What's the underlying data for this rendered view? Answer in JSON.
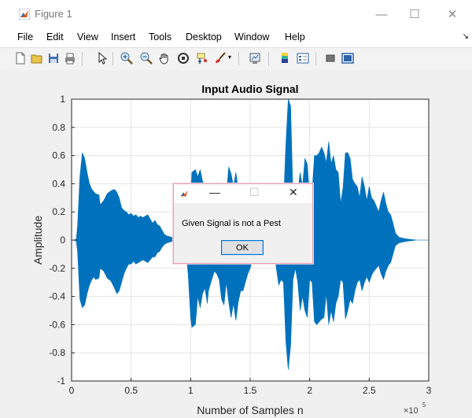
{
  "window": {
    "title": "Figure 1",
    "controls": {
      "minimize": "—",
      "maximize": "☐",
      "close": "✕"
    }
  },
  "menu": [
    "File",
    "Edit",
    "View",
    "Insert",
    "Tools",
    "Desktop",
    "Window",
    "Help"
  ],
  "menu_overflow": "↘",
  "toolbar": {
    "icons": [
      "new-figure-icon",
      "open-file-icon",
      "save-icon",
      "print-icon",
      "pointer-icon",
      "zoom-in-icon",
      "zoom-out-icon",
      "pan-icon",
      "rotate-3d-icon",
      "data-cursor-icon",
      "brush-icon",
      "link-plot-icon",
      "colorbar-icon",
      "legend-icon",
      "hide-plot-tools-icon",
      "show-plot-tools-icon"
    ]
  },
  "chart_data": {
    "type": "area",
    "title": "Input Audio Signal",
    "xlabel": "Number of Samples n",
    "ylabel": "Amplitude",
    "x_exponent_label": "×10",
    "x_exponent": "5",
    "xlim": [
      0,
      3
    ],
    "ylim": [
      -1,
      1
    ],
    "xticks": [
      "0",
      "0.5",
      "1",
      "1.5",
      "2",
      "2.5",
      "3"
    ],
    "yticks": [
      "1",
      "0.8",
      "0.6",
      "0.4",
      "0.2",
      "0",
      "-0.2",
      "-0.4",
      "-0.6",
      "-0.8",
      "-1"
    ],
    "grid": true,
    "color": "#0072bd",
    "envelope_x": [
      0.0,
      0.02,
      0.04,
      0.05,
      0.07,
      0.09,
      0.11,
      0.13,
      0.15,
      0.17,
      0.19,
      0.2,
      0.23,
      0.24,
      0.27,
      0.3,
      0.33,
      0.36,
      0.38,
      0.4,
      0.42,
      0.44,
      0.46,
      0.48,
      0.5,
      0.52,
      0.54,
      0.56,
      0.58,
      0.6,
      0.62,
      0.64,
      0.66,
      0.68,
      0.7,
      0.72,
      0.74,
      0.76,
      0.78,
      0.8,
      0.84,
      0.9,
      0.95,
      0.96,
      0.98,
      1.0,
      1.01,
      1.04,
      1.06,
      1.08,
      1.1,
      1.12,
      1.14,
      1.15,
      1.17,
      1.2,
      1.22,
      1.24,
      1.26,
      1.28,
      1.3,
      1.32,
      1.34,
      1.36,
      1.38,
      1.4,
      1.42,
      1.44,
      1.46,
      1.48,
      1.5,
      1.52,
      1.54,
      1.56,
      1.58,
      1.6,
      1.62,
      1.64,
      1.66,
      1.68,
      1.7,
      1.72,
      1.74,
      1.76,
      1.78,
      1.8,
      1.82,
      1.84,
      1.86,
      1.88,
      1.9,
      1.92,
      1.94,
      1.96,
      1.98,
      2.0,
      2.02,
      2.04,
      2.06,
      2.08,
      2.1,
      2.12,
      2.14,
      2.16,
      2.18,
      2.2,
      2.22,
      2.24,
      2.26,
      2.28,
      2.3,
      2.32,
      2.34,
      2.36,
      2.38,
      2.4,
      2.42,
      2.44,
      2.46,
      2.48,
      2.5,
      2.52,
      2.54,
      2.56,
      2.58,
      2.6,
      2.62,
      2.64,
      2.66,
      2.68,
      2.7,
      2.72,
      2.75,
      2.8,
      2.9,
      3.0
    ],
    "envelope_upper": [
      0.0,
      0.0,
      0.01,
      0.1,
      0.45,
      0.62,
      0.58,
      0.48,
      0.4,
      0.36,
      0.34,
      0.33,
      0.32,
      0.25,
      0.28,
      0.33,
      0.35,
      0.36,
      0.34,
      0.3,
      0.23,
      0.21,
      0.2,
      0.18,
      0.19,
      0.17,
      0.18,
      0.16,
      0.17,
      0.16,
      0.17,
      0.18,
      0.15,
      0.12,
      0.14,
      0.11,
      0.1,
      0.07,
      0.04,
      0.03,
      0.02,
      0.0,
      0.0,
      0.04,
      0.12,
      0.26,
      0.48,
      0.5,
      0.45,
      0.5,
      0.42,
      0.38,
      0.36,
      0.3,
      0.28,
      0.28,
      0.41,
      0.35,
      0.3,
      0.28,
      0.32,
      0.52,
      0.47,
      0.38,
      0.48,
      0.36,
      0.3,
      0.32,
      0.27,
      0.23,
      0.22,
      0.16,
      0.1,
      0.06,
      0.03,
      0.01,
      0.0,
      0.0,
      0.01,
      0.05,
      0.1,
      0.22,
      0.35,
      0.3,
      0.26,
      0.68,
      1.0,
      0.95,
      0.3,
      0.22,
      0.34,
      0.48,
      0.38,
      0.58,
      0.54,
      0.3,
      0.34,
      0.6,
      0.6,
      0.62,
      0.66,
      0.62,
      0.55,
      0.7,
      0.54,
      0.6,
      0.5,
      0.48,
      0.26,
      0.37,
      0.62,
      0.62,
      0.58,
      0.43,
      0.4,
      0.38,
      0.3,
      0.45,
      0.38,
      0.28,
      0.38,
      0.3,
      0.28,
      0.24,
      0.2,
      0.28,
      0.34,
      0.26,
      0.2,
      0.18,
      0.12,
      0.05,
      0.02,
      0.01,
      0.0,
      0.0
    ],
    "envelope_lower": [
      0.0,
      0.0,
      -0.01,
      -0.08,
      -0.42,
      -0.48,
      -0.46,
      -0.38,
      -0.32,
      -0.28,
      -0.26,
      -0.28,
      -0.27,
      -0.2,
      -0.22,
      -0.27,
      -0.29,
      -0.34,
      -0.38,
      -0.36,
      -0.3,
      -0.24,
      -0.2,
      -0.17,
      -0.17,
      -0.15,
      -0.17,
      -0.16,
      -0.15,
      -0.14,
      -0.15,
      -0.16,
      -0.14,
      -0.12,
      -0.12,
      -0.09,
      -0.08,
      -0.05,
      -0.03,
      -0.02,
      -0.01,
      0.0,
      0.0,
      -0.06,
      -0.25,
      -0.55,
      -0.62,
      -0.6,
      -0.4,
      -0.48,
      -0.38,
      -0.34,
      -0.45,
      -0.36,
      -0.3,
      -0.22,
      -0.24,
      -0.28,
      -0.42,
      -0.46,
      -0.3,
      -0.44,
      -0.55,
      -0.45,
      -0.57,
      -0.44,
      -0.36,
      -0.36,
      -0.3,
      -0.24,
      -0.2,
      -0.14,
      -0.09,
      -0.05,
      -0.03,
      -0.01,
      0.0,
      0.0,
      -0.01,
      -0.04,
      -0.08,
      -0.2,
      -0.32,
      -0.28,
      -0.3,
      -0.72,
      -0.92,
      -0.75,
      -0.28,
      -0.2,
      -0.3,
      -0.5,
      -0.4,
      -0.5,
      -0.55,
      -0.28,
      -0.3,
      -0.58,
      -0.6,
      -0.58,
      -0.56,
      -0.55,
      -0.38,
      -0.6,
      -0.5,
      -0.58,
      -0.45,
      -0.4,
      -0.28,
      -0.3,
      -0.56,
      -0.5,
      -0.42,
      -0.45,
      -0.36,
      -0.3,
      -0.28,
      -0.36,
      -0.3,
      -0.26,
      -0.3,
      -0.25,
      -0.22,
      -0.2,
      -0.18,
      -0.24,
      -0.28,
      -0.22,
      -0.18,
      -0.16,
      -0.1,
      -0.04,
      -0.02,
      -0.01,
      0.0,
      0.0
    ]
  },
  "dialog": {
    "message": "Given Signal is not a Pest",
    "ok_label": "OK",
    "controls": {
      "minimize": "—",
      "maximize": "☐",
      "close": "✕"
    }
  }
}
